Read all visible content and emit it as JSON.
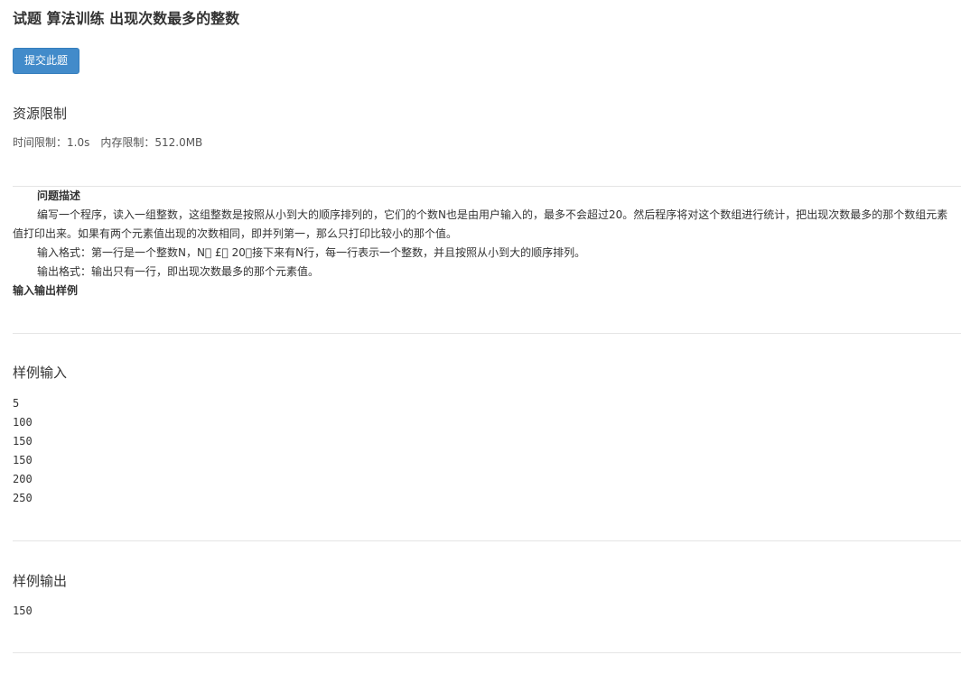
{
  "header": {
    "title": "试题 算法训练 出现次数最多的整数",
    "submit_label": "提交此题"
  },
  "resource": {
    "heading": "资源限制",
    "time_limit": "时间限制：1.0s",
    "memory_limit": "内存限制：512.0MB"
  },
  "problem": {
    "desc_heading": "问题描述",
    "desc_text": "编写一个程序，读入一组整数，这组整数是按照从小到大的顺序排列的，它们的个数N也是由用户输入的，最多不会超过20。然后程序将对这个数组进行统计，把出现次数最多的那个数组元素值打印出来。如果有两个元素值出现的次数相同，即并列第一，那么只打印比较小的那个值。",
    "input_format": "输入格式：第一行是一个整数N，N￿ £￿ 20；接下来有N行，每一行表示一个整数，并且按照从小到大的顺序排列。",
    "output_format": "输出格式：输出只有一行，即出现次数最多的那个元素值。",
    "io_sample_heading": "输入输出样例"
  },
  "sample_input": {
    "heading": "样例输入",
    "lines": [
      "5",
      "100",
      "150",
      "150",
      "200",
      "250"
    ]
  },
  "sample_output": {
    "heading": "样例输出",
    "lines": [
      "150"
    ]
  }
}
